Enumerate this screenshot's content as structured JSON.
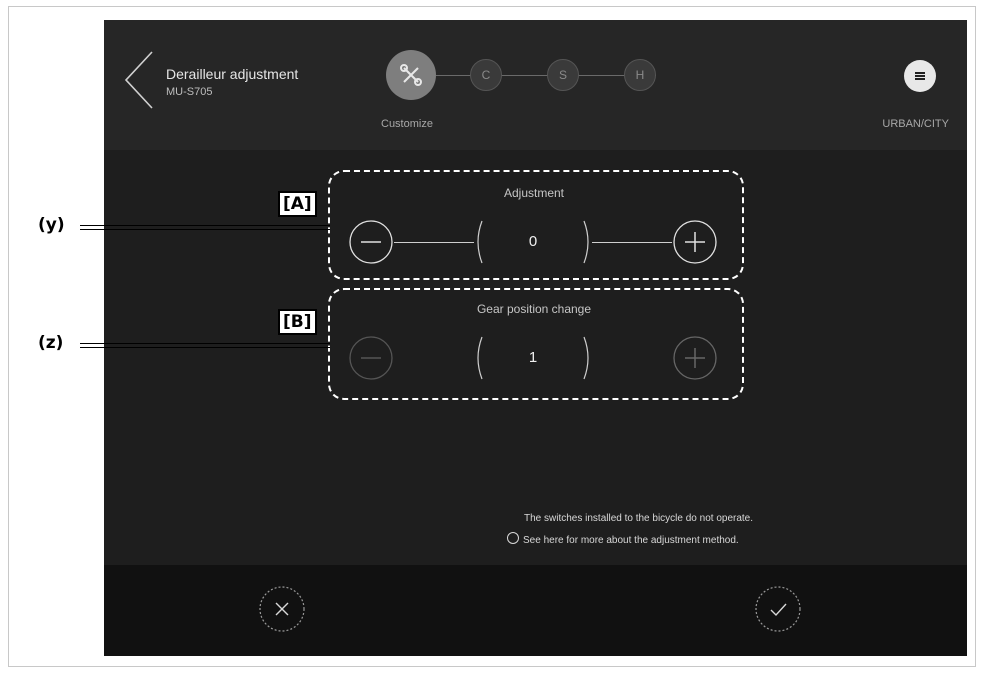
{
  "header": {
    "title": "Derailleur adjustment",
    "subtitle": "MU-S705",
    "steps": [
      "C",
      "S",
      "H"
    ],
    "step_label": "Customize",
    "mode_label": "URBAN/CITY"
  },
  "adjustment": {
    "title": "Adjustment",
    "value": "0"
  },
  "gear_position": {
    "title": "Gear position change",
    "value": "1"
  },
  "info": {
    "line1": "The switches installed to the bicycle do not operate.",
    "line2": "See here for more about the adjustment method."
  },
  "annotations": {
    "tag_a": "[A]",
    "tag_b": "[B]",
    "callout_y": "(y)",
    "callout_z": "(z)"
  },
  "colors": {
    "background": "#1e1e1e",
    "header": "#262626",
    "footer": "#111111"
  }
}
